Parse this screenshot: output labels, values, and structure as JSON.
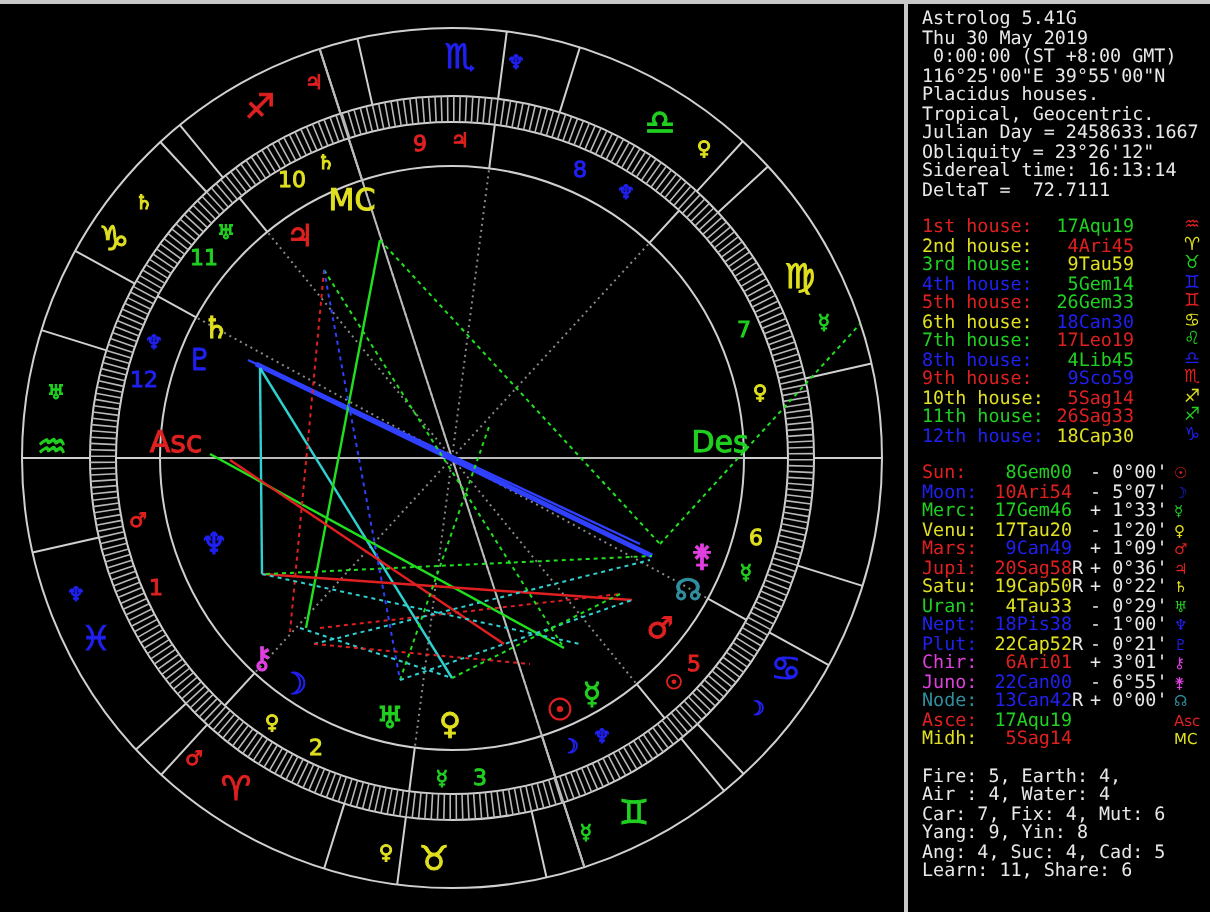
{
  "wheel": {
    "signs": [
      {
        "glyph": "♐",
        "color": "#e02020"
      },
      {
        "glyph": "♑",
        "color": "#e0e020"
      },
      {
        "glyph": "♒",
        "color": "#20d020"
      },
      {
        "glyph": "♓",
        "color": "#2020f0"
      },
      {
        "glyph": "♈",
        "color": "#e02020"
      },
      {
        "glyph": "♉",
        "color": "#e0e020"
      },
      {
        "glyph": "♊",
        "color": "#20d020"
      },
      {
        "glyph": "♋",
        "color": "#2020f0"
      },
      {
        "glyph": "♍",
        "color": "#e0e020"
      },
      {
        "glyph": "♎",
        "color": "#20d020"
      },
      {
        "glyph": "♏",
        "color": "#2020f0"
      }
    ],
    "sign_rulers": [
      {
        "glyph": "♃",
        "color": "#e02020"
      },
      {
        "glyph": "♆",
        "color": "#2020f0"
      },
      {
        "glyph": "♀",
        "color": "#e0e020"
      },
      {
        "glyph": "☿",
        "color": "#20d020"
      },
      {
        "glyph": "♄",
        "color": "#e0e020"
      },
      {
        "glyph": "♅",
        "color": "#20d020"
      },
      {
        "glyph": "♆",
        "color": "#2020f0"
      },
      {
        "glyph": "♂",
        "color": "#e02020"
      },
      {
        "glyph": "♀",
        "color": "#e0e020"
      },
      {
        "glyph": "☿",
        "color": "#20d020"
      },
      {
        "glyph": "☽",
        "color": "#2020f0"
      }
    ],
    "house_numbers": [
      {
        "text": "9",
        "color": "#e02020"
      },
      {
        "text": "10",
        "color": "#e0e020"
      },
      {
        "text": "11",
        "color": "#20d020"
      },
      {
        "text": "12",
        "color": "#2020f0"
      },
      {
        "text": "1",
        "color": "#e02020"
      },
      {
        "text": "2",
        "color": "#e0e020"
      },
      {
        "text": "3",
        "color": "#20d020"
      },
      {
        "text": "5",
        "color": "#e02020"
      },
      {
        "text": "6",
        "color": "#e0e020"
      },
      {
        "text": "7",
        "color": "#20d020"
      },
      {
        "text": "8",
        "color": "#2020f0"
      }
    ],
    "house_rulers": [
      {
        "glyph": "♃",
        "color": "#e02020"
      },
      {
        "glyph": "♄",
        "color": "#e0e020"
      },
      {
        "glyph": "♅",
        "color": "#20d020"
      },
      {
        "glyph": "♆",
        "color": "#2020f0"
      },
      {
        "glyph": "♂",
        "color": "#e02020"
      },
      {
        "glyph": "♀",
        "color": "#e0e020"
      },
      {
        "glyph": "☿",
        "color": "#20d020"
      },
      {
        "glyph": "☽",
        "color": "#2020f0"
      },
      {
        "glyph": "♆",
        "color": "#2020f0"
      },
      {
        "glyph": "☉",
        "color": "#e02020"
      },
      {
        "glyph": "☿",
        "color": "#20d020"
      },
      {
        "glyph": "♀",
        "color": "#e0e020"
      },
      {
        "glyph": "♆",
        "color": "#2020f0"
      }
    ],
    "points": [
      {
        "glyph": "♃",
        "color": "#e02020"
      },
      {
        "glyph": "MC",
        "color": "#e0e020"
      },
      {
        "glyph": "♄",
        "color": "#e0e020"
      },
      {
        "glyph": "♇",
        "color": "#2020f0"
      },
      {
        "glyph": "Asc",
        "color": "#e02020"
      },
      {
        "glyph": "Des",
        "color": "#20d020"
      },
      {
        "glyph": "♆",
        "color": "#2020f0"
      },
      {
        "glyph": "⚷",
        "color": "#e040e0"
      },
      {
        "glyph": "☽",
        "color": "#2020f0"
      },
      {
        "glyph": "♅",
        "color": "#20d020"
      },
      {
        "glyph": "♀",
        "color": "#e0e020"
      },
      {
        "glyph": "☉",
        "color": "#e02020"
      },
      {
        "glyph": "☿",
        "color": "#20d020"
      },
      {
        "glyph": "♂",
        "color": "#e02020"
      },
      {
        "glyph": "☊",
        "color": "#3090a0"
      },
      {
        "glyph": "⚵",
        "color": "#e040e0"
      }
    ]
  },
  "info": [
    "Astrolog 5.41G",
    "Thu 30 May 2019",
    " 0:00:00 (ST +8:00 GMT)",
    "116°25'00\"E 39°55'00\"N",
    "Placidus houses.",
    "Tropical, Geocentric.",
    "Julian Day = 2458633.1667",
    "Obliquity = 23°26'12\"",
    "Sidereal time: 16:13:14",
    "DeltaT =  72.7111"
  ],
  "houses": [
    {
      "label": "1st house:",
      "value": {
        "text": "17Aqu19",
        "color": "#20d020"
      },
      "glyph": "♒",
      "color": "#e02020"
    },
    {
      "label": "2nd house:",
      "value": {
        "text": "4Ari45",
        "color": "#e02020"
      },
      "glyph": "♈",
      "color": "#e0e020"
    },
    {
      "label": "3rd house:",
      "value": {
        "text": "9Tau59",
        "color": "#e0e020"
      },
      "glyph": "♉",
      "color": "#20d020"
    },
    {
      "label": "4th house:",
      "value": {
        "text": "5Gem14",
        "color": "#20d020"
      },
      "glyph": "♊",
      "color": "#2020f0"
    },
    {
      "label": "5th house:",
      "value": {
        "text": "26Gem33",
        "color": "#20d020"
      },
      "glyph": "♊",
      "color": "#e02020"
    },
    {
      "label": "6th house:",
      "value": {
        "text": "18Can30",
        "color": "#2020f0"
      },
      "glyph": "♋",
      "color": "#e0e020"
    },
    {
      "label": "7th house:",
      "value": {
        "text": "17Leo19",
        "color": "#e02020"
      },
      "glyph": "♌",
      "color": "#20d020"
    },
    {
      "label": "8th house:",
      "value": {
        "text": "4Lib45",
        "color": "#20d020"
      },
      "glyph": "♎",
      "color": "#2020f0"
    },
    {
      "label": "9th house:",
      "value": {
        "text": "9Sco59",
        "color": "#2020f0"
      },
      "glyph": "♏",
      "color": "#e02020"
    },
    {
      "label": "10th house:",
      "value": {
        "text": "5Sag14",
        "color": "#e02020"
      },
      "glyph": "♐",
      "color": "#e0e020"
    },
    {
      "label": "11th house:",
      "value": {
        "text": "26Sag33",
        "color": "#e02020"
      },
      "glyph": "♐",
      "color": "#20d020"
    },
    {
      "label": "12th house:",
      "value": {
        "text": "18Cap30",
        "color": "#e0e020"
      },
      "glyph": "♑",
      "color": "#2020f0"
    }
  ],
  "planets": [
    {
      "label": "Sun:",
      "value": {
        "text": "8Gem00",
        "color": "#20d020"
      },
      "offset": "- 0°00'",
      "glyph": "☉",
      "color": "#e02020"
    },
    {
      "label": "Moon:",
      "value": {
        "text": "10Ari54",
        "color": "#e02020"
      },
      "offset": "- 5°07'",
      "glyph": "☽",
      "color": "#2020f0"
    },
    {
      "label": "Merc:",
      "value": {
        "text": "17Gem46",
        "color": "#20d020"
      },
      "offset": "+ 1°33'",
      "glyph": "☿",
      "color": "#20d020"
    },
    {
      "label": "Venu:",
      "value": {
        "text": "17Tau20",
        "color": "#e0e020"
      },
      "offset": "- 1°20'",
      "glyph": "♀",
      "color": "#e0e020"
    },
    {
      "label": "Mars:",
      "value": {
        "text": "9Can49",
        "color": "#2020f0"
      },
      "offset": "+ 1°09'",
      "glyph": "♂",
      "color": "#e02020"
    },
    {
      "label": "Jupi:",
      "value": {
        "text": "20Sag58",
        "color": "#e02020"
      },
      "flag": "R",
      "offset": "+ 0°36'",
      "glyph": "♃",
      "color": "#e02020"
    },
    {
      "label": "Satu:",
      "value": {
        "text": "19Cap50",
        "color": "#e0e020"
      },
      "flag": "R",
      "offset": "+ 0°22'",
      "glyph": "♄",
      "color": "#e0e020"
    },
    {
      "label": "Uran:",
      "value": {
        "text": "4Tau33",
        "color": "#e0e020"
      },
      "offset": "- 0°29'",
      "glyph": "♅",
      "color": "#20d020"
    },
    {
      "label": "Nept:",
      "value": {
        "text": "18Pis38",
        "color": "#2020f0"
      },
      "offset": "- 1°00'",
      "glyph": "♆",
      "color": "#2020f0"
    },
    {
      "label": "Plut:",
      "value": {
        "text": "22Cap52",
        "color": "#e0e020"
      },
      "flag": "R",
      "offset": "- 0°21'",
      "glyph": "♇",
      "color": "#2020f0"
    },
    {
      "label": "Chir:",
      "value": {
        "text": "6Ari01",
        "color": "#e02020"
      },
      "offset": "+ 3°01'",
      "glyph": "⚷",
      "color": "#e040e0"
    },
    {
      "label": "Juno:",
      "value": {
        "text": "22Can00",
        "color": "#2020f0"
      },
      "offset": "- 6°55'",
      "glyph": "⚵",
      "color": "#e040e0"
    },
    {
      "label": "Node:",
      "value": {
        "text": "13Can42",
        "color": "#2020f0"
      },
      "flag": "R",
      "offset": "+ 0°00'",
      "glyph": "☊",
      "color": "#3090a0"
    },
    {
      "label": "Asce:",
      "value": {
        "text": "17Aqu19",
        "color": "#20d020"
      },
      "glyph": "Asc",
      "color": "#e02020"
    },
    {
      "label": "Midh:",
      "value": {
        "text": "5Sag14",
        "color": "#e02020"
      },
      "glyph": "MC",
      "color": "#e0e020"
    }
  ],
  "balance": [
    "Fire: 5, Earth: 4,",
    "Air : 4, Water: 4",
    "Car: 7, Fix: 4, Mut: 6",
    "Yang: 9, Yin: 8",
    "Ang: 4, Suc: 4, Cad: 5",
    "Learn: 11, Share: 6"
  ]
}
